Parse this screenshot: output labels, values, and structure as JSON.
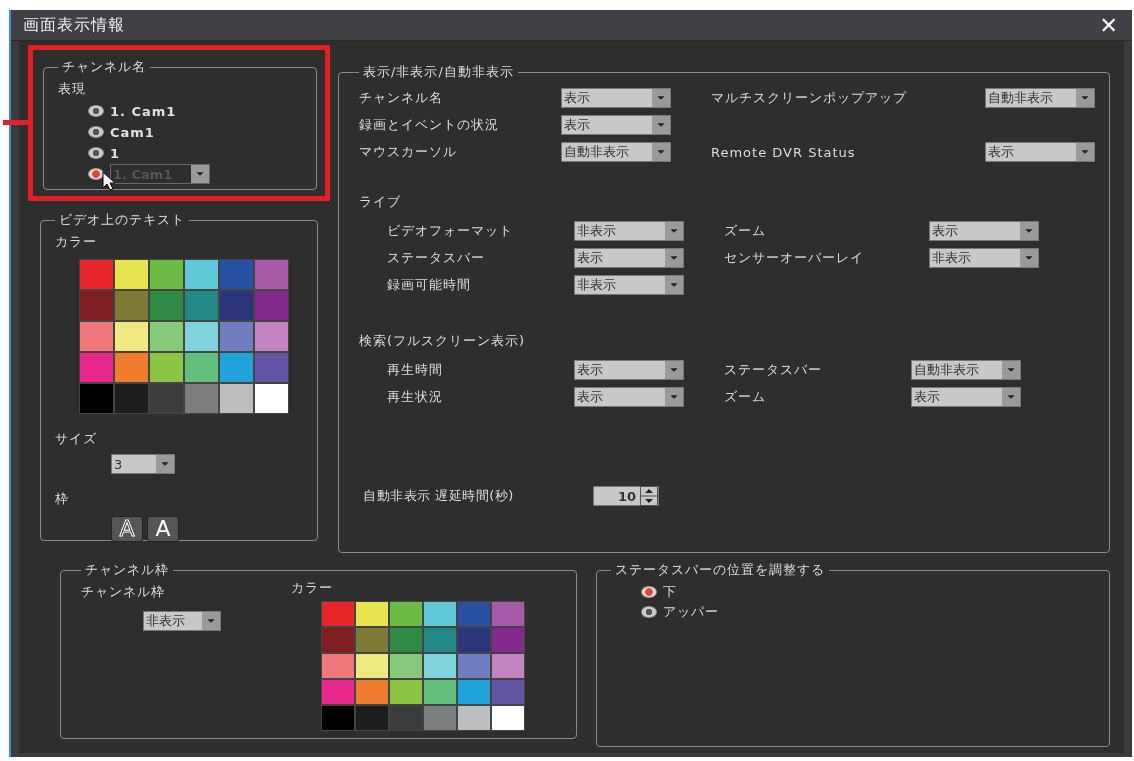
{
  "window": {
    "title": "画面表示情報",
    "close": "✕"
  },
  "channel_name": {
    "legend": "チャンネル名",
    "label": "表現",
    "highlighted": true,
    "options": [
      {
        "label": "1. Cam1",
        "selected": false,
        "kind": "text"
      },
      {
        "label": "Cam1",
        "selected": false,
        "kind": "text"
      },
      {
        "label": "1",
        "selected": false,
        "kind": "text"
      },
      {
        "label": "1. Cam1",
        "selected": true,
        "kind": "dropdown",
        "disabled": true
      }
    ]
  },
  "video_text": {
    "legend": "ビデオ上のテキスト",
    "color_label": "カラー",
    "swatches": [
      {
        "color": "#e8262a"
      },
      {
        "color": "#e6e44f"
      },
      {
        "color": "#6cbb45"
      },
      {
        "color": "#5fc8d6"
      },
      {
        "color": "#2752a4"
      },
      {
        "color": "#a75aa8"
      },
      {
        "color": "#7e1e22"
      },
      {
        "color": "#7d7b36"
      },
      {
        "color": "#2f8a45"
      },
      {
        "color": "#238886"
      },
      {
        "color": "#2c347a"
      },
      {
        "color": "#842a8c"
      },
      {
        "color": "#f07878"
      },
      {
        "color": "#eee981"
      },
      {
        "color": "#85c97a"
      },
      {
        "color": "#7fd3dc"
      },
      {
        "color": "#6f7ec0"
      },
      {
        "color": "#c382c0"
      },
      {
        "color": "#e8278a"
      },
      {
        "color": "#f07d2f"
      },
      {
        "color": "#8cc444"
      },
      {
        "color": "#62bf7c"
      },
      {
        "color": "#20a3dc"
      },
      {
        "color": "#6454a4"
      },
      {
        "color": "#000000"
      },
      {
        "color": "#1c1d1d"
      },
      {
        "color": "#3a3b3d"
      },
      {
        "color": "#7d7e80"
      },
      {
        "color": "#bcbdbf"
      },
      {
        "color": "#ffffff"
      }
    ],
    "size_label": "サイズ",
    "size_value": "3",
    "frame_label": "枠",
    "frame_buttons": [
      {
        "label": "A",
        "kind": "outline"
      },
      {
        "label": "A",
        "kind": "solid"
      }
    ]
  },
  "display": {
    "legend": "表示/非表示/自動非表示",
    "rows": [
      {
        "left": {
          "label": "チャンネル名",
          "value": "表示"
        },
        "right": {
          "label": "マルチスクリーンポップアップ",
          "value": "自動非表示"
        }
      },
      {
        "left": {
          "label": "録画とイベントの状況",
          "value": "表示"
        }
      },
      {
        "left": {
          "label": "マウスカーソル",
          "value": "自動非表示"
        },
        "right": {
          "label": "Remote DVR Status",
          "value": "表示"
        }
      }
    ],
    "live": {
      "heading": "ライブ",
      "rows": [
        {
          "left": {
            "label": "ビデオフォーマット",
            "value": "非表示"
          },
          "right": {
            "label": "ズーム",
            "value": "表示"
          }
        },
        {
          "left": {
            "label": "ステータスバー",
            "value": "表示"
          },
          "right": {
            "label": "センサーオーバーレイ",
            "value": "非表示"
          }
        },
        {
          "left": {
            "label": "録画可能時間",
            "value": "非表示"
          }
        }
      ]
    },
    "search": {
      "heading": "検索(フルスクリーン表示)",
      "rows": [
        {
          "left": {
            "label": "再生時間",
            "value": "表示"
          },
          "right": {
            "label": "ステータスバー",
            "value": "自動非表示"
          }
        },
        {
          "left": {
            "label": "再生状況",
            "value": "表示"
          },
          "right": {
            "label": "ズーム",
            "value": "表示"
          }
        }
      ]
    },
    "delay": {
      "label": "自動非表示 遅延時間(秒)",
      "value": "10"
    }
  },
  "channel_frame": {
    "legend": "チャンネル枠",
    "label": "チャンネル枠",
    "value": "非表示",
    "color_label": "カラー",
    "swatches": [
      {
        "color": "#e8262a"
      },
      {
        "color": "#e6e44f"
      },
      {
        "color": "#6cbb45"
      },
      {
        "color": "#5fc8d6"
      },
      {
        "color": "#2752a4"
      },
      {
        "color": "#a75aa8"
      },
      {
        "color": "#7e1e22"
      },
      {
        "color": "#7d7b36"
      },
      {
        "color": "#2f8a45"
      },
      {
        "color": "#238886"
      },
      {
        "color": "#2c347a"
      },
      {
        "color": "#842a8c"
      },
      {
        "color": "#f07878"
      },
      {
        "color": "#eee981"
      },
      {
        "color": "#85c97a"
      },
      {
        "color": "#7fd3dc"
      },
      {
        "color": "#6f7ec0"
      },
      {
        "color": "#c382c0"
      },
      {
        "color": "#e8278a"
      },
      {
        "color": "#f07d2f"
      },
      {
        "color": "#8cc444"
      },
      {
        "color": "#62bf7c"
      },
      {
        "color": "#20a3dc"
      },
      {
        "color": "#6454a4"
      },
      {
        "color": "#000000"
      },
      {
        "color": "#1c1d1d"
      },
      {
        "color": "#3a3b3d"
      },
      {
        "color": "#7d7e80"
      },
      {
        "color": "#bcbdbf"
      },
      {
        "color": "#ffffff"
      }
    ]
  },
  "status_bar_position": {
    "legend": "ステータスバーの位置を調整する",
    "options": [
      {
        "label": "下",
        "selected": true
      },
      {
        "label": "アッパー",
        "selected": false
      }
    ]
  }
}
